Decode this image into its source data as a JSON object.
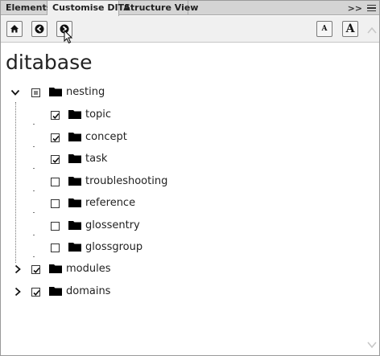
{
  "tabs": [
    {
      "label": "Elements",
      "active": false
    },
    {
      "label": "Customise DITA",
      "active": true
    },
    {
      "label": "Structure View",
      "active": false
    }
  ],
  "tabbar": {
    "overflow_label": ">>",
    "menu_icon": "panel-menu-icon"
  },
  "toolbar": {
    "buttons": [
      "home-icon",
      "back-arrow-icon",
      "forward-arrow-icon"
    ],
    "font_small_label": "A",
    "font_large_label": "A"
  },
  "document": {
    "title": "ditabase"
  },
  "tree": {
    "nesting": {
      "label": "nesting",
      "expanded": true,
      "state": "partial",
      "children": [
        {
          "label": "topic",
          "checked": true
        },
        {
          "label": "concept",
          "checked": true
        },
        {
          "label": "task",
          "checked": true
        },
        {
          "label": "troubleshooting",
          "checked": false
        },
        {
          "label": "reference",
          "checked": false
        },
        {
          "label": "glossentry",
          "checked": false
        },
        {
          "label": "glossgroup",
          "checked": false
        }
      ]
    },
    "modules": {
      "label": "modules",
      "expanded": false,
      "checked": true
    },
    "domains": {
      "label": "domains",
      "expanded": false,
      "checked": true
    }
  },
  "colors": {
    "tab_bg": "#d4d4d4",
    "active_tab_bg": "#f0f0f0",
    "toolbar_bg": "#f0f0f0",
    "border": "#9a9a9a"
  }
}
